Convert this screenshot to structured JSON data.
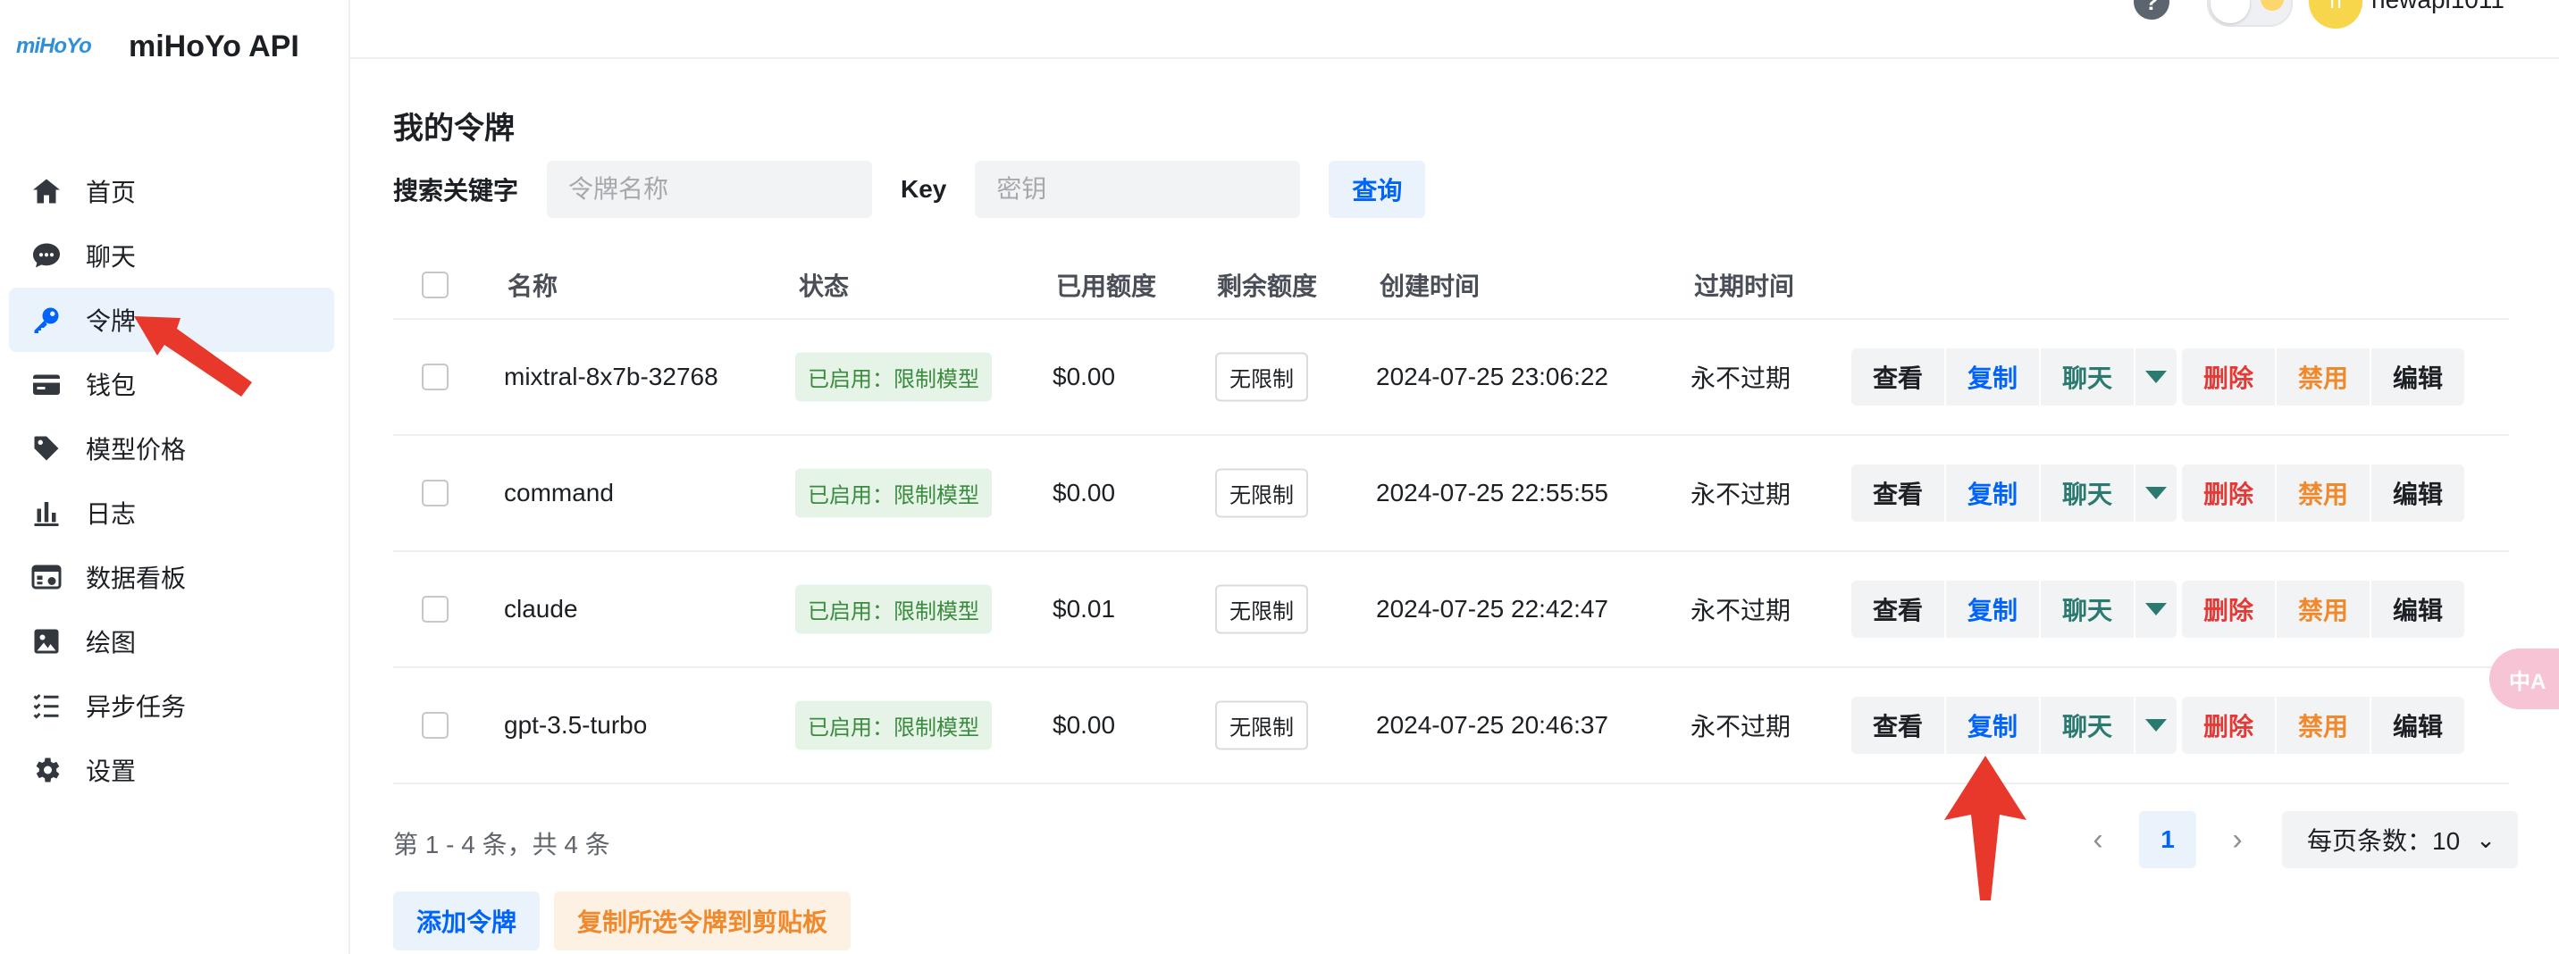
{
  "brand": {
    "logo_text": "miHoYo",
    "title": "miHoYo API"
  },
  "sidebar": {
    "items": [
      {
        "label": "首页",
        "icon": "home-icon"
      },
      {
        "label": "聊天",
        "icon": "chat-icon"
      },
      {
        "label": "令牌",
        "icon": "key-icon",
        "active": true
      },
      {
        "label": "钱包",
        "icon": "wallet-icon"
      },
      {
        "label": "模型价格",
        "icon": "price-tag-icon"
      },
      {
        "label": "日志",
        "icon": "bar-chart-icon"
      },
      {
        "label": "数据看板",
        "icon": "dashboard-icon"
      },
      {
        "label": "绘图",
        "icon": "image-icon"
      },
      {
        "label": "异步任务",
        "icon": "task-list-icon"
      },
      {
        "label": "设置",
        "icon": "gear-icon"
      }
    ]
  },
  "header": {
    "help": "?",
    "user_initial": "n",
    "user_name": "newapi1011"
  },
  "main": {
    "title": "我的令牌",
    "search": {
      "keyword_label": "搜索关键字",
      "keyword_placeholder": "令牌名称",
      "key_label": "Key",
      "key_placeholder": "密钥",
      "query_label": "查询"
    },
    "table": {
      "headers": [
        "名称",
        "状态",
        "已用额度",
        "剩余额度",
        "创建时间",
        "过期时间"
      ],
      "actions": {
        "view": "查看",
        "copy": "复制",
        "chat": "聊天",
        "delete": "删除",
        "disable": "禁用",
        "edit": "编辑"
      },
      "rows": [
        {
          "name": "mixtral-8x7b-32768",
          "status": "已启用：限制模型",
          "used": "$0.00",
          "remaining": "无限制",
          "created": "2024-07-25 23:06:22",
          "expires": "永不过期"
        },
        {
          "name": "command",
          "status": "已启用：限制模型",
          "used": "$0.00",
          "remaining": "无限制",
          "created": "2024-07-25 22:55:55",
          "expires": "永不过期"
        },
        {
          "name": "claude",
          "status": "已启用：限制模型",
          "used": "$0.01",
          "remaining": "无限制",
          "created": "2024-07-25 22:42:47",
          "expires": "永不过期"
        },
        {
          "name": "gpt-3.5-turbo",
          "status": "已启用：限制模型",
          "used": "$0.00",
          "remaining": "无限制",
          "created": "2024-07-25 20:46:37",
          "expires": "永不过期"
        }
      ]
    },
    "summary": "第 1 - 4 条，共 4 条",
    "pagination": {
      "current": "1",
      "page_size_label": "每页条数：10"
    },
    "buttons": {
      "add": "添加令牌",
      "copy_selected": "复制所选令牌到剪贴板"
    }
  },
  "translate_fab": "中A",
  "colors": {
    "primary": "#0064fa",
    "danger": "#e53935",
    "warning": "#f0892b",
    "success_bg": "#e6f4e7",
    "annotation": "#e8382b"
  }
}
